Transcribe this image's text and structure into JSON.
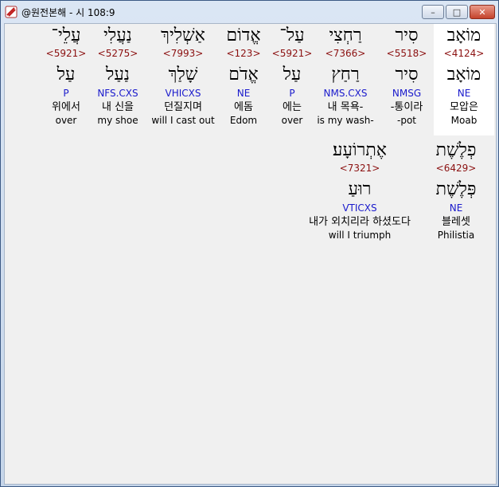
{
  "window": {
    "title": "@원전본해 - 시 108:9",
    "controls": {
      "minimize": "–",
      "maximize": "□",
      "close": "✕"
    }
  },
  "row1": [
    {
      "heb": "מוֹאָב",
      "strong": "<4124>",
      "lemma": "מוֹאָב",
      "morph": "NE",
      "kor": "모압은",
      "eng": "Moab"
    },
    {
      "heb": "סִיר",
      "strong": "<5518>",
      "lemma": "סִיר",
      "morph": "NMSG",
      "kor": "-통이라",
      "eng": "-pot"
    },
    {
      "heb": "רַחְצִי",
      "strong": "<7366>",
      "lemma": "רַחַץ",
      "morph": "NMS.CXS",
      "kor": "내 목욕-",
      "eng": "is my wash-"
    },
    {
      "heb": "עַל־",
      "strong": "<5921>",
      "lemma": "עַל",
      "morph": "P",
      "kor": "에는",
      "eng": "over"
    },
    {
      "heb": "אֱדוֹם",
      "strong": "<123>",
      "lemma": "אֱדֹם",
      "morph": "NE",
      "kor": "에돔",
      "eng": "Edom"
    },
    {
      "heb": "אַשְׁלִיךְ",
      "strong": "<7993>",
      "lemma": "שָׁלַךְ",
      "morph": "VHICXS",
      "kor": "던질지며",
      "eng": "will I cast out"
    },
    {
      "heb": "נַעֲלִי",
      "strong": "<5275>",
      "lemma": "נַעַל",
      "morph": "NFS.CXS",
      "kor": "내 신을",
      "eng": "my shoe"
    },
    {
      "heb": "עֲלֵי־",
      "strong": "<5921>",
      "lemma": "עַל",
      "morph": "P",
      "kor": "위에서",
      "eng": "over"
    }
  ],
  "row2": [
    {
      "heb": "פְלֶשֶׁת",
      "strong": "<6429>",
      "lemma": "פְּלֶשֶׁת",
      "morph": "NE",
      "kor": "블레셋",
      "eng": "Philistia"
    },
    {
      "heb": "אֶתְרוֹעָע׃",
      "strong": "<7321>",
      "lemma": "רוּעַ",
      "morph": "VTICXS",
      "kor": "내가 외치리라 하셨도다",
      "eng": "will I triumph"
    }
  ]
}
